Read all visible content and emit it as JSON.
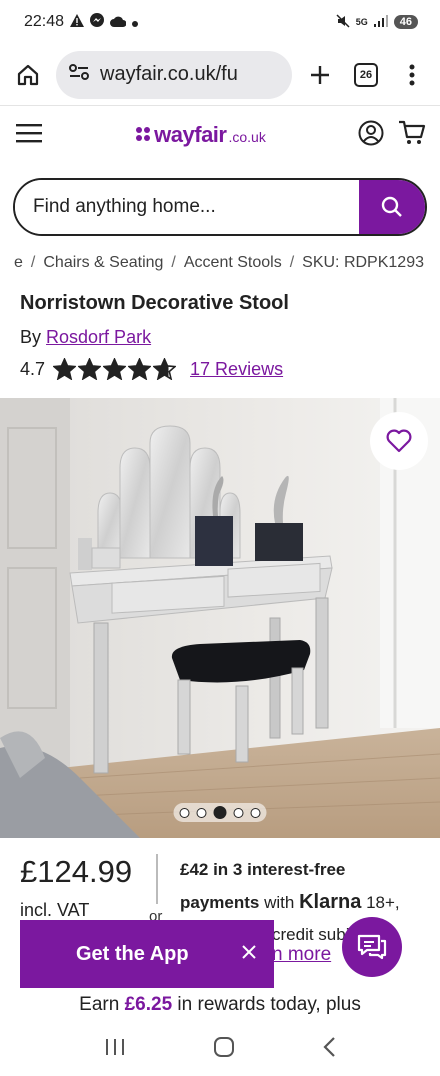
{
  "status": {
    "time": "22:48",
    "battery": "46",
    "network": "5G"
  },
  "browser": {
    "url": "wayfair.co.uk/fu",
    "tab_count": "26"
  },
  "header": {
    "logo_main": "wayfair",
    "logo_sub": ".co.uk"
  },
  "search": {
    "placeholder": "Find anything home..."
  },
  "breadcrumb": {
    "items": [
      "e",
      "Chairs & Seating",
      "Accent Stools",
      "SKU: RDPK1293"
    ]
  },
  "product": {
    "title": "Norristown Decorative Stool",
    "by_label": "By",
    "brand": "Rosdorf Park",
    "rating": "4.7",
    "rating_value": 4.7,
    "rating_max": 5,
    "reviews": "17 Reviews",
    "image_count": 5,
    "active_image_index": 2
  },
  "price": {
    "amount": "£124.99",
    "vat": "incl. VAT",
    "or": "or",
    "klarna_bold": "£42 in 3 interest-free",
    "klarna_payments": "payments",
    "klarna_with": "with",
    "klarna_logo": "Klarna",
    "klarna_age": "18+,",
    "klarna_credit": "credit subje",
    "learn_more": "n more"
  },
  "app_banner": {
    "label": "Get the App"
  },
  "rewards": {
    "prefix": "Earn",
    "amount": "£6.25",
    "suffix": "in rewards today, plus"
  },
  "colors": {
    "brand": "#7b189f",
    "text": "#222222"
  }
}
